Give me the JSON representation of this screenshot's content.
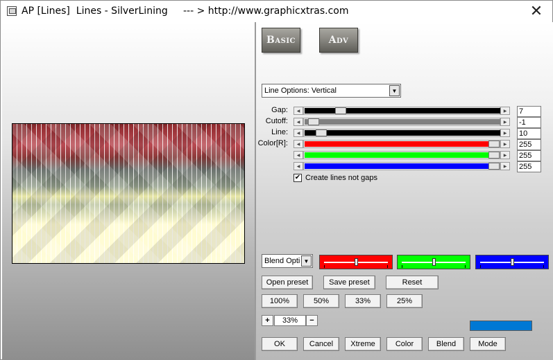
{
  "window": {
    "title": "AP [Lines]  Lines - SilverLining     --- > http://www.graphicxtras.com",
    "close_glyph": "✕"
  },
  "preview": {
    "colors": {
      "top": "#8e2a2e",
      "middle": "#94a08c",
      "bottom": "#fffdd8"
    }
  },
  "modes": {
    "basic": "Basic",
    "adv": "Adv"
  },
  "line_options": {
    "selected": "Line Options: Vertical"
  },
  "sliders": [
    {
      "label": "Gap:",
      "value": "7",
      "fill_color": "#000000",
      "position": 0.16
    },
    {
      "label": "Cutoff:",
      "value": "-1",
      "fill_color": "#808080",
      "position": 0.02
    },
    {
      "label": "Line:",
      "value": "10",
      "fill_color": "#000000",
      "position": 0.06
    },
    {
      "label": "Color[R]:",
      "value": "255",
      "fill_color": "#ff0000",
      "position": 1.0
    },
    {
      "label": "",
      "value": "255",
      "fill_color": "#00ff00",
      "position": 1.0
    },
    {
      "label": "",
      "value": "255",
      "fill_color": "#0000ff",
      "position": 1.0
    }
  ],
  "create_lines": {
    "label": "Create lines not gaps",
    "checked": true,
    "mark": "✔"
  },
  "blend": {
    "dropdown_value": "Blend Options",
    "boxes": [
      {
        "color": "#ff0000",
        "position": 0.5
      },
      {
        "color": "#00ff00",
        "position": 0.5
      },
      {
        "color": "#0000ff",
        "position": 0.5
      }
    ]
  },
  "preset_buttons": {
    "open": "Open preset",
    "save": "Save preset",
    "reset": "Reset"
  },
  "zoom_presets": [
    "100%",
    "50%",
    "33%",
    "25%"
  ],
  "zoom": {
    "plus": "+",
    "value": "33%",
    "minus": "−"
  },
  "swatch_color": "#0078d4",
  "bottom_buttons": [
    "OK",
    "Cancel",
    "Xtreme",
    "Color",
    "Blend",
    "Mode"
  ]
}
